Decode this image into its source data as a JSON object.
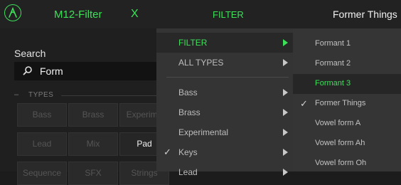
{
  "app": {
    "name": "M12-Filter",
    "close_label": "X"
  },
  "search": {
    "label": "Search",
    "value": "Form"
  },
  "types": {
    "header": "TYPES",
    "dash": "–",
    "buttons": [
      {
        "label": "Bass",
        "active": false
      },
      {
        "label": "Brass",
        "active": false
      },
      {
        "label": "Experime",
        "active": false
      },
      {
        "label": "Lead",
        "active": false
      },
      {
        "label": "Mix",
        "active": false
      },
      {
        "label": "Pad",
        "active": true
      },
      {
        "label": "Sequence",
        "active": false
      },
      {
        "label": "SFX",
        "active": false
      },
      {
        "label": "Strings",
        "active": false
      }
    ]
  },
  "filter_menu": {
    "title": "FILTER",
    "items": [
      {
        "label": "FILTER",
        "checked": false,
        "highlight": true
      },
      {
        "label": "ALL TYPES",
        "checked": false,
        "highlight": false
      },
      {
        "label": "Bass",
        "checked": false,
        "highlight": false
      },
      {
        "label": "Brass",
        "checked": false,
        "highlight": false
      },
      {
        "label": "Experimental",
        "checked": false,
        "highlight": false
      },
      {
        "label": "Keys",
        "checked": true,
        "highlight": false
      },
      {
        "label": "Lead",
        "checked": false,
        "highlight": false
      }
    ],
    "check_glyph": "✓"
  },
  "submenu": {
    "title": "Former Things",
    "items": [
      {
        "label": "Formant 1",
        "checked": false,
        "highlight": false
      },
      {
        "label": "Formant 2",
        "checked": false,
        "highlight": false
      },
      {
        "label": "Formant 3",
        "checked": false,
        "highlight": true
      },
      {
        "label": "Former Things",
        "checked": true,
        "highlight": false
      },
      {
        "label": "Vowel form A",
        "checked": false,
        "highlight": false
      },
      {
        "label": "Vowel form Ah",
        "checked": false,
        "highlight": false
      },
      {
        "label": "Vowel form Oh",
        "checked": false,
        "highlight": false
      }
    ],
    "check_glyph": "✓"
  },
  "colors": {
    "accent": "#3ee05a",
    "panel": "#343434",
    "background": "#1c1c1c"
  }
}
